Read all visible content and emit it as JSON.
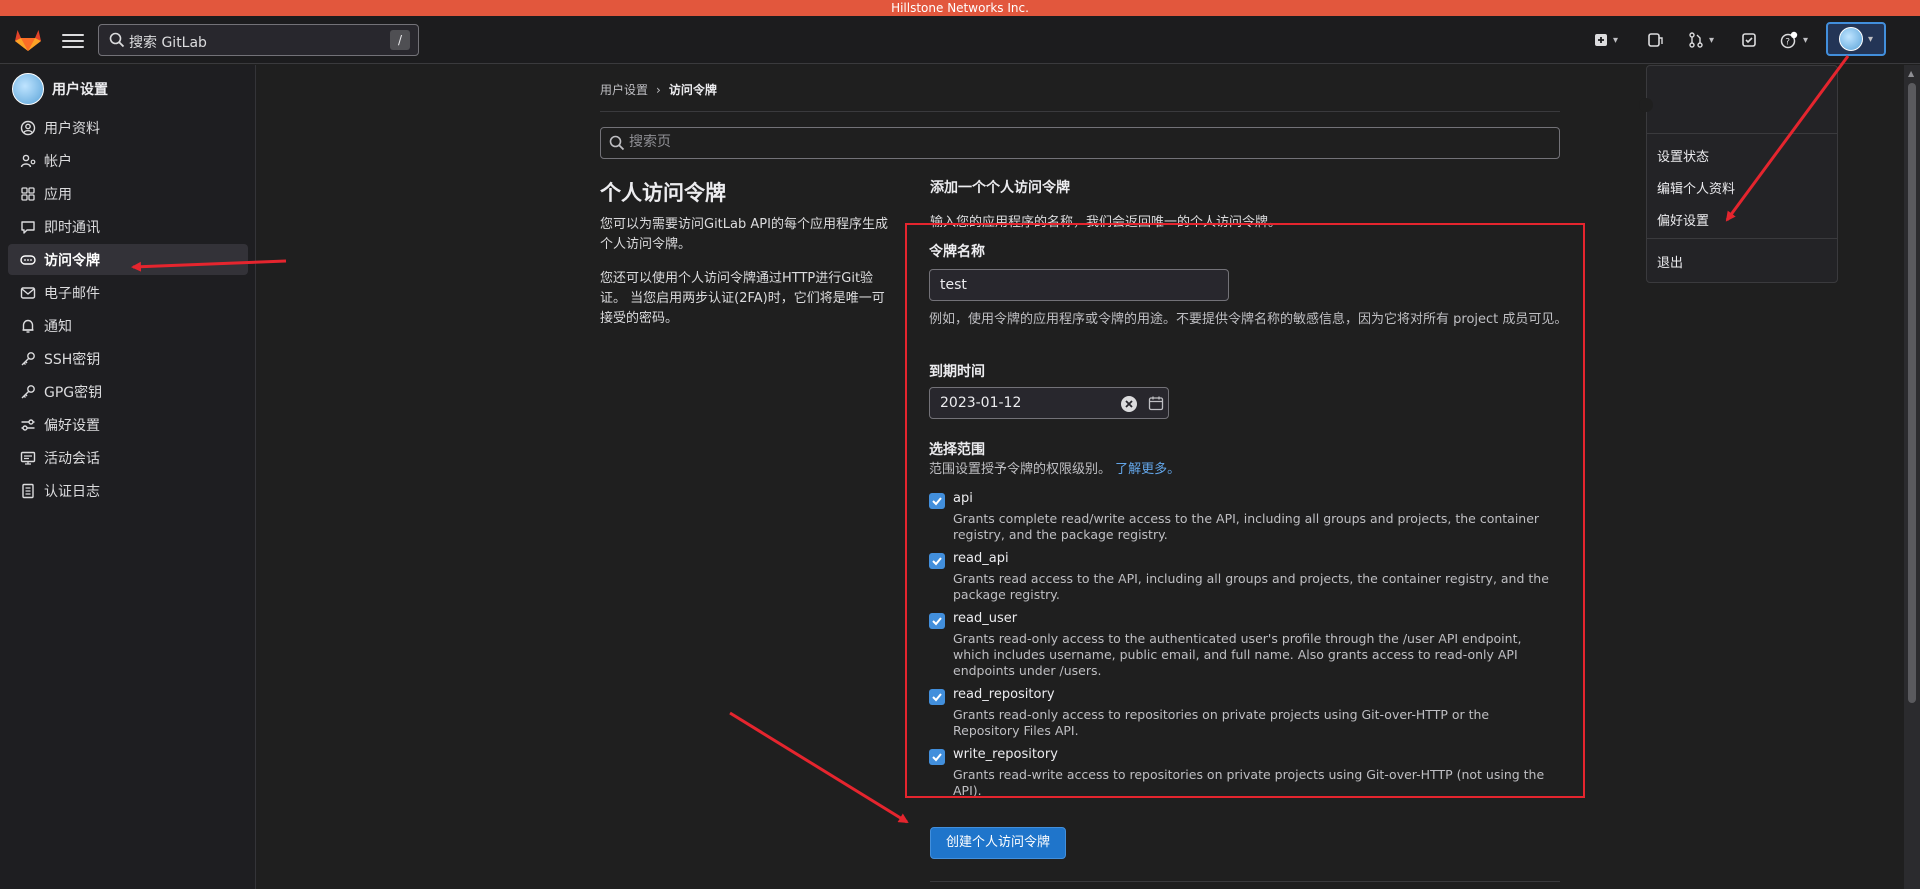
{
  "system_bar": {
    "title": "Hillstone Networks Inc."
  },
  "navbar": {
    "search_text": "搜索 GitLab",
    "search_shortcut": "/",
    "icons": [
      "gitlab-logo",
      "menu-icon",
      "search-icon",
      "plus-icon",
      "issues-icon",
      "merge-request-icon",
      "todo-icon",
      "help-icon",
      "avatar"
    ]
  },
  "sidebar": {
    "title": "用户设置",
    "items": [
      {
        "label": "用户资料",
        "icon": "profile-icon"
      },
      {
        "label": "帐户",
        "icon": "account-icon"
      },
      {
        "label": "应用",
        "icon": "applications-icon"
      },
      {
        "label": "即时通讯",
        "icon": "chat-icon"
      },
      {
        "label": "访问令牌",
        "icon": "token-icon",
        "active": true
      },
      {
        "label": "电子邮件",
        "icon": "mail-icon"
      },
      {
        "label": "通知",
        "icon": "bell-icon"
      },
      {
        "label": "SSH密钥",
        "icon": "key-icon"
      },
      {
        "label": "GPG密钥",
        "icon": "key-icon"
      },
      {
        "label": "偏好设置",
        "icon": "preferences-icon"
      },
      {
        "label": "活动会话",
        "icon": "monitor-icon"
      },
      {
        "label": "认证日志",
        "icon": "log-icon"
      }
    ]
  },
  "breadcrumb": {
    "parent": "用户设置",
    "separator": "›",
    "current": "访问令牌"
  },
  "page_search": {
    "placeholder": "搜索页"
  },
  "intro": {
    "title": "个人访问令牌",
    "para1": "您可以为需要访问GitLab API的每个应用程序生成个人访问令牌。",
    "para2": "您还可以使用个人访问令牌通过HTTP进行Git验证。 当您启用两步认证(2FA)时，它们将是唯一可接受的密码。"
  },
  "form": {
    "title": "添加一个个人访问令牌",
    "subtitle": "输入您的应用程序的名称，我们会返回唯一的个人访问令牌。",
    "token_name_label": "令牌名称",
    "token_name_value": "test",
    "token_name_help": "例如，使用令牌的应用程序或令牌的用途。不要提供令牌名称的敏感信息，因为它将对所有 project 成员可见。",
    "expires_label": "到期时间",
    "expires_value": "2023-01-12",
    "scopes_label": "选择范围",
    "scopes_help": "范围设置授予令牌的权限级别。",
    "scopes_link": "了解更多。",
    "scopes": [
      {
        "name": "api",
        "checked": true,
        "desc": "Grants complete read/write access to the API, including all groups and projects, the container registry, and the package registry."
      },
      {
        "name": "read_api",
        "checked": true,
        "desc": "Grants read access to the API, including all groups and projects, the container registry, and the package registry."
      },
      {
        "name": "read_user",
        "checked": true,
        "desc": "Grants read-only access to the authenticated user's profile through the /user API endpoint, which includes username, public email, and full name. Also grants access to read-only API endpoints under /users."
      },
      {
        "name": "read_repository",
        "checked": true,
        "desc": "Grants read-only access to repositories on private projects using Git-over-HTTP or the Repository Files API."
      },
      {
        "name": "write_repository",
        "checked": true,
        "desc": "Grants read-write access to repositories on private projects using Git-over-HTTP (not using the API)."
      }
    ],
    "submit_label": "创建个人访问令牌"
  },
  "user_menu": {
    "items": [
      "设置状态",
      "编辑个人资料",
      "偏好设置"
    ],
    "signout": "退出"
  },
  "colors": {
    "system_bar": "#e2573d",
    "accent": "#428fdc",
    "button": "#1f75cb",
    "annotation": "#e5252e",
    "background": "#1f1f1f"
  }
}
